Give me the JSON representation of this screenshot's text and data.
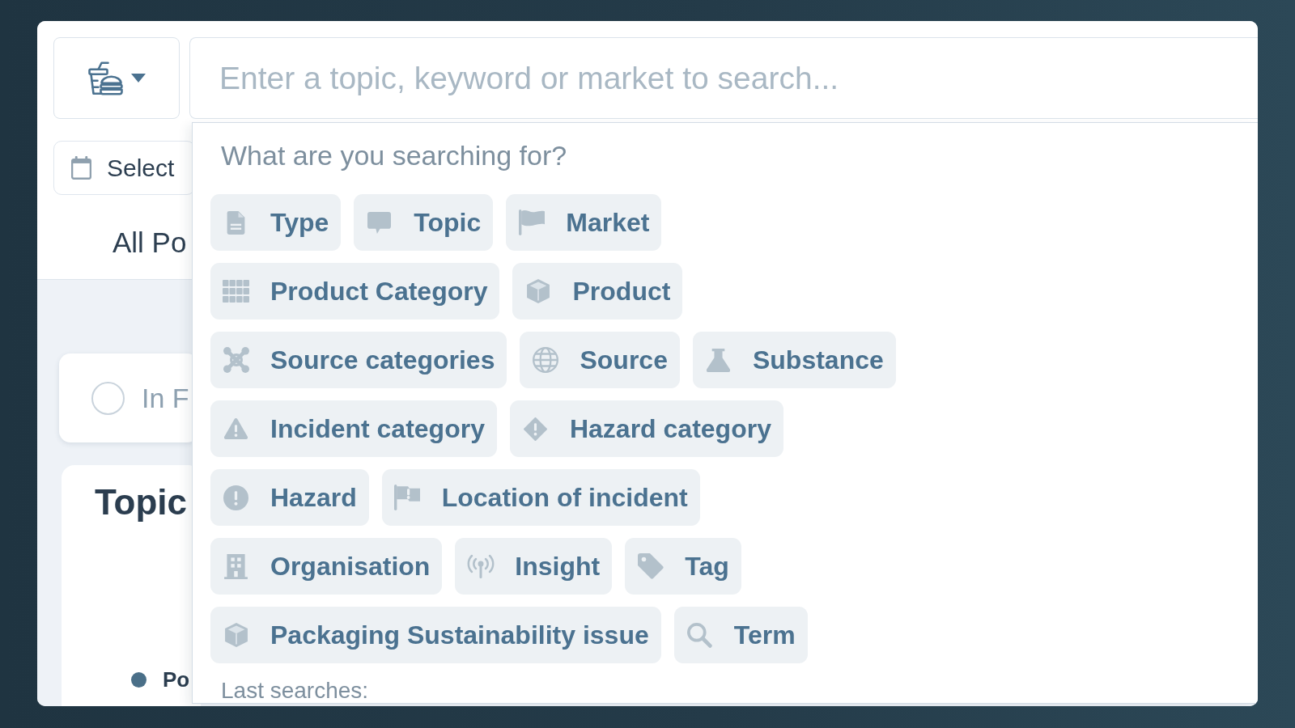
{
  "toolbar": {
    "search": {
      "placeholder": "Enter a topic, keyword or market to search..."
    }
  },
  "date_picker": {
    "label": "Select"
  },
  "tab": {
    "label": "All Po"
  },
  "filter_card": {
    "label": "In F",
    "checked": false
  },
  "topics_card": {
    "title": "Topic",
    "legend": [
      {
        "label": "Po"
      }
    ]
  },
  "search_dropdown": {
    "heading": "What are you searching for?",
    "options": [
      {
        "label": "Type",
        "kind": "type"
      },
      {
        "label": "Topic",
        "kind": "topic"
      },
      {
        "label": "Market",
        "kind": "market"
      },
      {
        "label": "Product Category",
        "kind": "productcategory"
      },
      {
        "label": "Product",
        "kind": "product"
      },
      {
        "label": "Source categories",
        "kind": "sourcecategory"
      },
      {
        "label": "Source",
        "kind": "source"
      },
      {
        "label": "Substance",
        "kind": "substance"
      },
      {
        "label": "Incident category",
        "kind": "incidentcategory"
      },
      {
        "label": "Hazard category",
        "kind": "hazardcategory"
      },
      {
        "label": "Hazard",
        "kind": "hazard"
      },
      {
        "label": "Location of incident",
        "kind": "location"
      },
      {
        "label": "Organisation",
        "kind": "organisation"
      },
      {
        "label": "Insight",
        "kind": "insight"
      },
      {
        "label": "Tag",
        "kind": "tag"
      },
      {
        "label": "Packaging Sustainability issue",
        "kind": "packaging"
      },
      {
        "label": "Term",
        "kind": "term"
      }
    ],
    "footer": "Last searches:"
  }
}
